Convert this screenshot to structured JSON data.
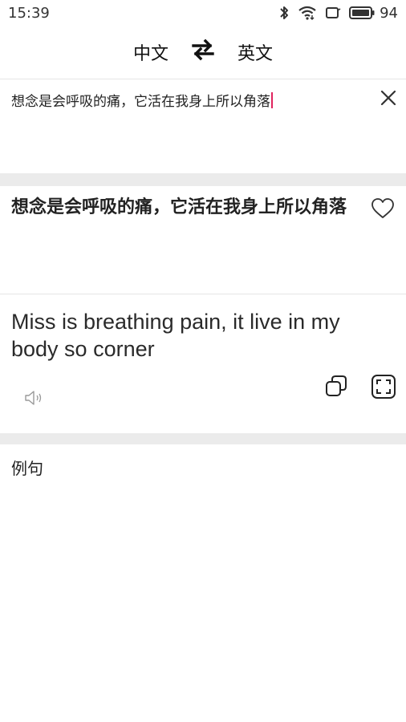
{
  "status_bar": {
    "time": "15:39",
    "battery": "94"
  },
  "lang_bar": {
    "source_lang": "中文",
    "target_lang": "英文"
  },
  "input": {
    "text": "想念是会呼吸的痛，它活在我身上所以角落"
  },
  "source": {
    "text": "想念是会呼吸的痛，它活在我身上所以角落"
  },
  "translation": {
    "text": "Miss is breathing pain, it live in my body so corner"
  },
  "examples": {
    "label": "例句"
  },
  "colors": {
    "caret": "#e0245e",
    "band": "#ebebeb"
  },
  "icons": [
    "bluetooth-icon",
    "wifi-icon",
    "screen-icon",
    "battery-icon",
    "swap-icon",
    "close-icon",
    "heart-icon",
    "speaker-icon",
    "copy-icon",
    "fullscreen-icon"
  ]
}
